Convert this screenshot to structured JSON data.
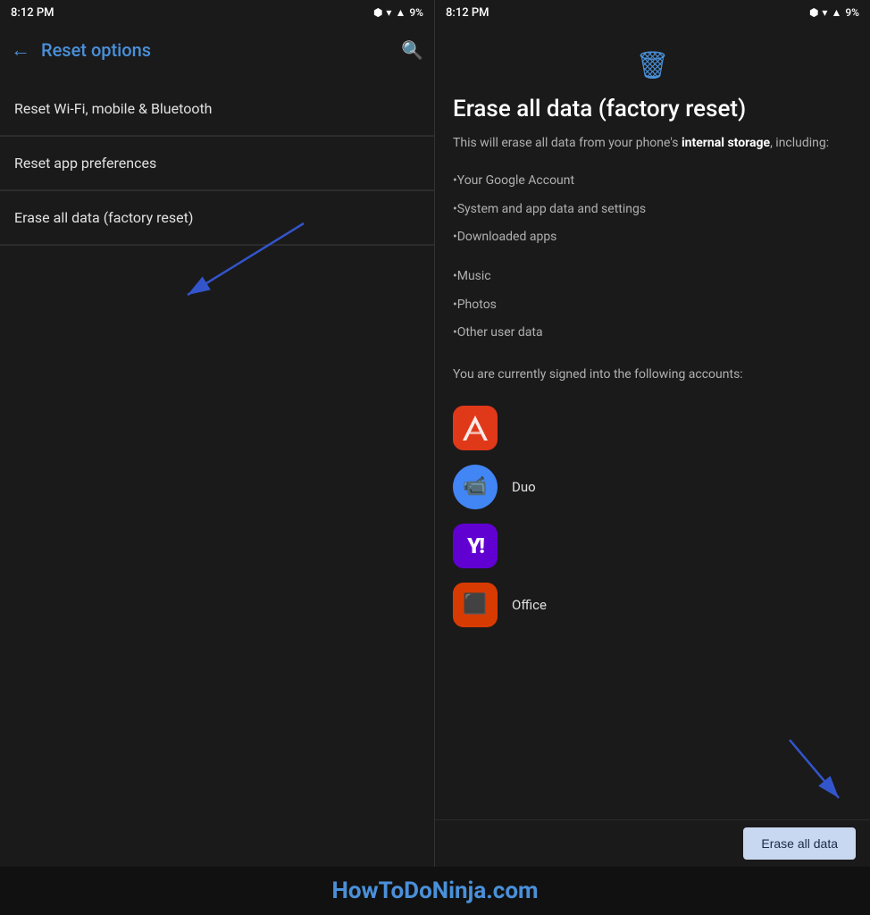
{
  "left_screen": {
    "status_bar": {
      "time": "8:12 PM",
      "battery": "9%"
    },
    "toolbar": {
      "back_label": "←",
      "title": "Reset options",
      "search_icon": "search"
    },
    "menu_items": [
      {
        "label": "Reset Wi-Fi, mobile & Bluetooth"
      },
      {
        "label": "Reset app preferences"
      },
      {
        "label": "Erase all data (factory reset)"
      }
    ]
  },
  "right_screen": {
    "status_bar": {
      "time": "8:12 PM",
      "battery": "9%"
    },
    "trash_icon": "🗑",
    "title": "Erase all data (factory reset)",
    "description_normal": "This will erase all data from your phone's ",
    "description_bold": "internal storage",
    "description_suffix": ", including:",
    "bullet_items": [
      "•Your Google Account",
      "•System and app data and settings",
      "•Downloaded apps",
      "•Music",
      "•Photos",
      "•Other user data"
    ],
    "accounts_text": "You are currently signed into the following accounts:",
    "apps": [
      {
        "name": "Adobe",
        "label": "",
        "type": "adobe"
      },
      {
        "name": "Duo",
        "label": "Duo",
        "type": "duo"
      },
      {
        "name": "Yahoo",
        "label": "",
        "type": "yahoo"
      },
      {
        "name": "Office",
        "label": "Office",
        "type": "office"
      }
    ],
    "erase_button_label": "Erase all data"
  },
  "watermark": {
    "text": "HowToDoNinja.com"
  }
}
